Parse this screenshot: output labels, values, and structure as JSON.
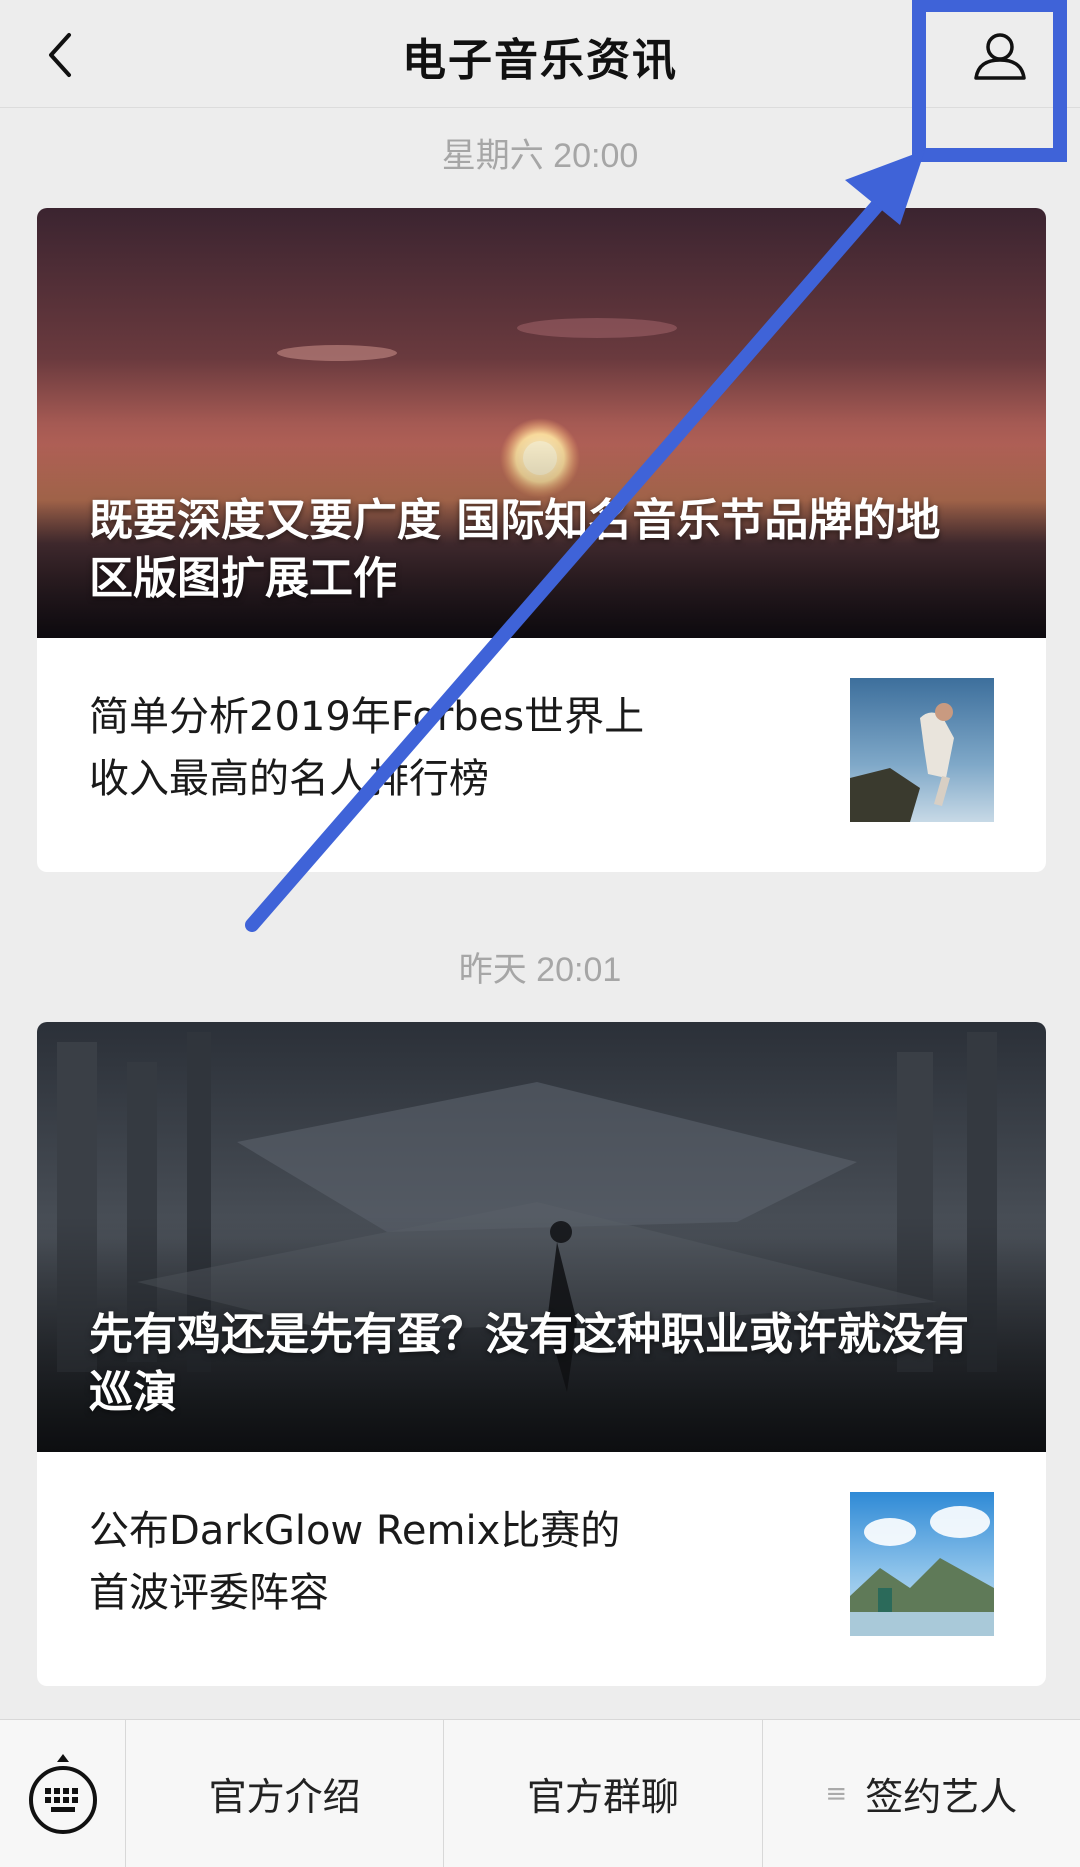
{
  "header": {
    "title": "电子音乐资讯",
    "back_icon": "chevron-left-icon",
    "profile_icon": "person-icon"
  },
  "feed": [
    {
      "time": "星期六 20:00",
      "hero_title": "既要深度又要广度 国际知名音乐节品牌的地区版图扩展工作",
      "item_title": "简单分析2019年Forbes世界上收入最高的名人排行榜"
    },
    {
      "time": "昨天 20:01",
      "hero_title": "先有鸡还是先有蛋？没有这种职业或许就没有巡演",
      "item_title": "公布DarkGlow Remix比赛的首波评委阵容"
    }
  ],
  "bottom_menu": {
    "keyboard_icon": "keyboard-icon",
    "items": [
      "官方介绍",
      "官方群聊",
      "签约艺人"
    ],
    "submenu_icon": "menu-lines-icon"
  },
  "annotation": {
    "color": "#3f63d8"
  }
}
